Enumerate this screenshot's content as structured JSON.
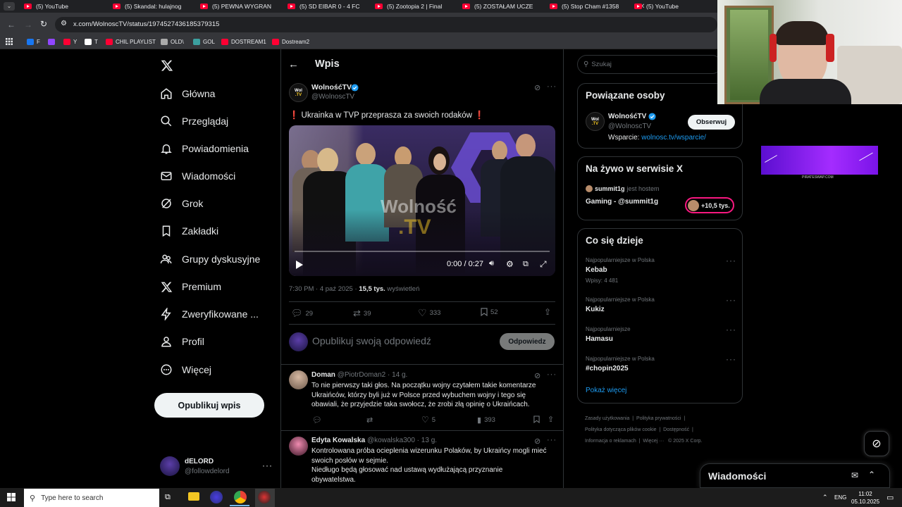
{
  "browser": {
    "tabs": [
      {
        "title": "(5) YouTube"
      },
      {
        "title": "(5) Skandal: hulajnog"
      },
      {
        "title": "(5) PEWNA WYGRAN"
      },
      {
        "title": "(5) SD EIBAR 0 - 4 FC"
      },
      {
        "title": "(5) Zootopia 2 | Final"
      },
      {
        "title": "(5) ZOSTAŁAM UCZE"
      },
      {
        "title": "(5) Stop Cham #1358"
      },
      {
        "title": "(5) YouTube"
      }
    ],
    "url": "x.com/WolnoscTV/status/1974527436185379315",
    "bookmarks": [
      {
        "label": "F",
        "color": "#1877f2"
      },
      {
        "label": "",
        "color": "#9146ff"
      },
      {
        "label": "Y",
        "color": "#ff0033"
      },
      {
        "label": "T",
        "color": "#ffffff"
      },
      {
        "label": "CHIL PLAYLIST",
        "color": "#ff0033"
      },
      {
        "label": "OLD\\",
        "color": "#aaaaaa"
      },
      {
        "label": "GOL",
        "color": "#3ca0a0"
      },
      {
        "label": "DOSTREAM1",
        "color": "#ff0033"
      },
      {
        "label": "Dostream2",
        "color": "#ff0033"
      }
    ]
  },
  "nav": {
    "items": [
      {
        "label": "Główna",
        "icon": "home-icon"
      },
      {
        "label": "Przeglądaj",
        "icon": "search-icon"
      },
      {
        "label": "Powiadomienia",
        "icon": "bell-icon"
      },
      {
        "label": "Wiadomości",
        "icon": "mail-icon"
      },
      {
        "label": "Grok",
        "icon": "grok-icon"
      },
      {
        "label": "Zakładki",
        "icon": "bookmark-icon"
      },
      {
        "label": "Grupy dyskusyjne",
        "icon": "people-icon"
      },
      {
        "label": "Premium",
        "icon": "x-logo-icon"
      },
      {
        "label": "Zweryfikowane ...",
        "icon": "lightning-icon"
      },
      {
        "label": "Profil",
        "icon": "person-icon"
      },
      {
        "label": "Więcej",
        "icon": "more-circle-icon"
      }
    ],
    "post_button": "Opublikuj wpis",
    "account": {
      "name": "dELORD",
      "handle": "@followdelord"
    }
  },
  "post": {
    "header_title": "Wpis",
    "author_name": "WolnośćTV",
    "author_handle": "@WolnoscTV",
    "text": "❗ Ukrainka w TVP przeprasza za swoich rodaków ❗",
    "video": {
      "watermark_top": "Wolność",
      "watermark_bottom": ".TV",
      "time": "0:00 / 0:27",
      "progress": 0
    },
    "timestamp": "7:30 PM · 4 paź 2025 · ",
    "views_count": "15,5 tys.",
    "views_label": " wyświetleń",
    "stats": {
      "replies": "29",
      "reposts": "39",
      "likes": "333",
      "bookmarks": "52"
    },
    "reply_placeholder": "Opublikuj swoją odpowiedź",
    "reply_button": "Odpowiedz"
  },
  "replies": [
    {
      "name": "Doman",
      "handle": "@PiotrDoman2 · 14 g.",
      "lines": [
        "To nie pierwszy taki głos. Na początku wojny czytałem takie komentarze",
        "Ukraińców, którzy byli już w Polsce przed wybuchem wojny i tego się",
        "obawiali, że przyjedzie taka swołocz, że zrobi złą opinię o Ukraińcach."
      ],
      "likes": "5",
      "views": "393"
    },
    {
      "name": "Edyta Kowalska",
      "handle": "@kowalska300 · 13 g.",
      "lines": [
        "Kontrolowana próba ocieplenia wizerunku Polaków, by Ukraińcy mogli mieć",
        "swoich posłów w sejmie.",
        "Niedługo będą głosować nad ustawą wydłużającą przyznanie",
        "obywatelstwa."
      ]
    }
  ],
  "right": {
    "search_placeholder": "Szukaj",
    "related": {
      "title": "Powiązane osoby",
      "name": "WolnośćTV",
      "handle": "@WolnoscTV",
      "follow": "Obserwuj",
      "bio_prefix": "Wsparcie: ",
      "bio_link": "wolnosc.tv/wsparcie/"
    },
    "live": {
      "title": "Na żywo w serwisie X",
      "host": "summit1g",
      "host_suffix": "jest hostem",
      "stream_title": "Gaming - @summit1g",
      "viewers": "+10,5 tys."
    },
    "trends": {
      "title": "Co się dzieje",
      "items": [
        {
          "category": "Najpopularniejsze w Polska",
          "name": "Kebab",
          "posts": "Wpisy: 4 481"
        },
        {
          "category": "Najpopularniejsze w Polska",
          "name": "Kukiz",
          "posts": ""
        },
        {
          "category": "Najpopularniejsze",
          "name": "Hamasu",
          "posts": ""
        },
        {
          "category": "Najpopularniejsze w Polska",
          "name": "#chopin2025",
          "posts": ""
        }
      ],
      "show_more": "Pokaż więcej"
    },
    "footer": {
      "line1": [
        "Zasady użytkowania",
        "Polityka prywatności"
      ],
      "line2": [
        "Polityka dotycząca plików cookie",
        "Dostępność"
      ],
      "line3": [
        "Informacja o reklamach",
        "Więcej ···",
        "© 2025 X Corp."
      ]
    },
    "messages": "Wiadomości",
    "ad_caption": "PIRATESWAP.COM"
  },
  "taskbar": {
    "search_placeholder": "Type here to search",
    "lang": "ENG",
    "time": "11:02",
    "date": "05.10.2025"
  },
  "colors": {
    "accent": "#1d9bf0",
    "verified": "#1d9bf0",
    "live": "#f91880",
    "ad": "#8a2be2"
  }
}
